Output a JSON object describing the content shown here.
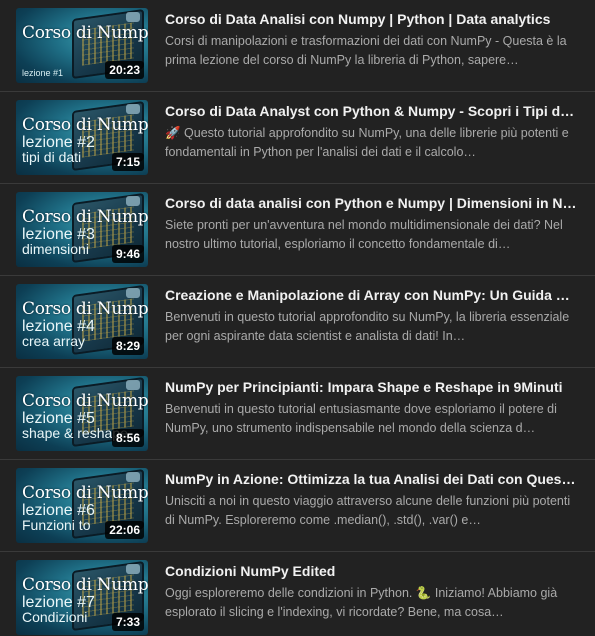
{
  "videos": [
    {
      "thumb_title": "Corso di Numpy",
      "thumb_line2": "",
      "thumb_line3": "",
      "thumb_small": "lezione #1",
      "duration": "20:23",
      "title": "Corso di Data Analisi con Numpy | Python | Data analytics",
      "description": "Corsi di manipolazioni e trasformazioni dei dati con NumPy - Questa è la prima lezione del corso di NumPy la libreria di Python, sapere…"
    },
    {
      "thumb_title": "Corso di Numpy",
      "thumb_line2": "lezione #2",
      "thumb_line3": "tipi di dati",
      "thumb_small": "",
      "duration": "7:15",
      "title": "Corso di Data Analyst con Python & Numpy - Scopri i Tipi di Dat…",
      "description": "🚀 Questo tutorial approfondito su NumPy, una delle librerie più potenti e fondamentali in Python per l'analisi dei dati e il calcolo…"
    },
    {
      "thumb_title": "Corso di Numpy",
      "thumb_line2": "lezione #3",
      "thumb_line3": "dimensioni",
      "thumb_small": "",
      "duration": "9:46",
      "title": "Corso di data analisi con Python e Numpy | Dimensioni in NumPy",
      "description": "Siete pronti per un'avventura nel mondo multidimensionale dei dati? Nel nostro ultimo tutorial, esploriamo il concetto fondamentale di…"
    },
    {
      "thumb_title": "Corso di Numpy",
      "thumb_line2": "lezione #4",
      "thumb_line3": "crea array",
      "thumb_small": "",
      "duration": "8:29",
      "title": "Creazione e Manipolazione di Array con NumPy: Un Guida Prati…",
      "description": "Benvenuti in questo tutorial approfondito su NumPy, la libreria essenziale per ogni aspirante data scientist e analista di dati! In…"
    },
    {
      "thumb_title": "Corso di Numpy",
      "thumb_line2": "lezione #5",
      "thumb_line3": "shape & reshape",
      "thumb_small": "",
      "duration": "8:56",
      "title": "NumPy per Principianti: Impara Shape e Reshape in 9Minuti",
      "description": "Benvenuti in questo tutorial entusiasmante dove esploriamo il potere di NumPy, uno strumento indispensabile nel mondo della scienza d…"
    },
    {
      "thumb_title": "Corso di Numpy",
      "thumb_line2": "lezione #6",
      "thumb_line3": "Funzioni to",
      "thumb_small": "",
      "duration": "22:06",
      "title": "NumPy in Azione: Ottimizza la tua Analisi dei Dati con Queste F…",
      "description": "Unisciti a noi in questo viaggio attraverso alcune delle funzioni più potenti di NumPy. Esploreremo come .median(), .std(), .var() e…"
    },
    {
      "thumb_title": "Corso di Numpy",
      "thumb_line2": "lezione #7",
      "thumb_line3": "Condizioni",
      "thumb_small": "",
      "duration": "7:33",
      "title": "Condizioni NumPy Edited",
      "description": "Oggi esploreremo delle condizioni in Python. 🐍 Iniziamo! Abbiamo già esplorato il slicing e l'indexing, vi ricordate? Bene, ma cosa…"
    }
  ]
}
